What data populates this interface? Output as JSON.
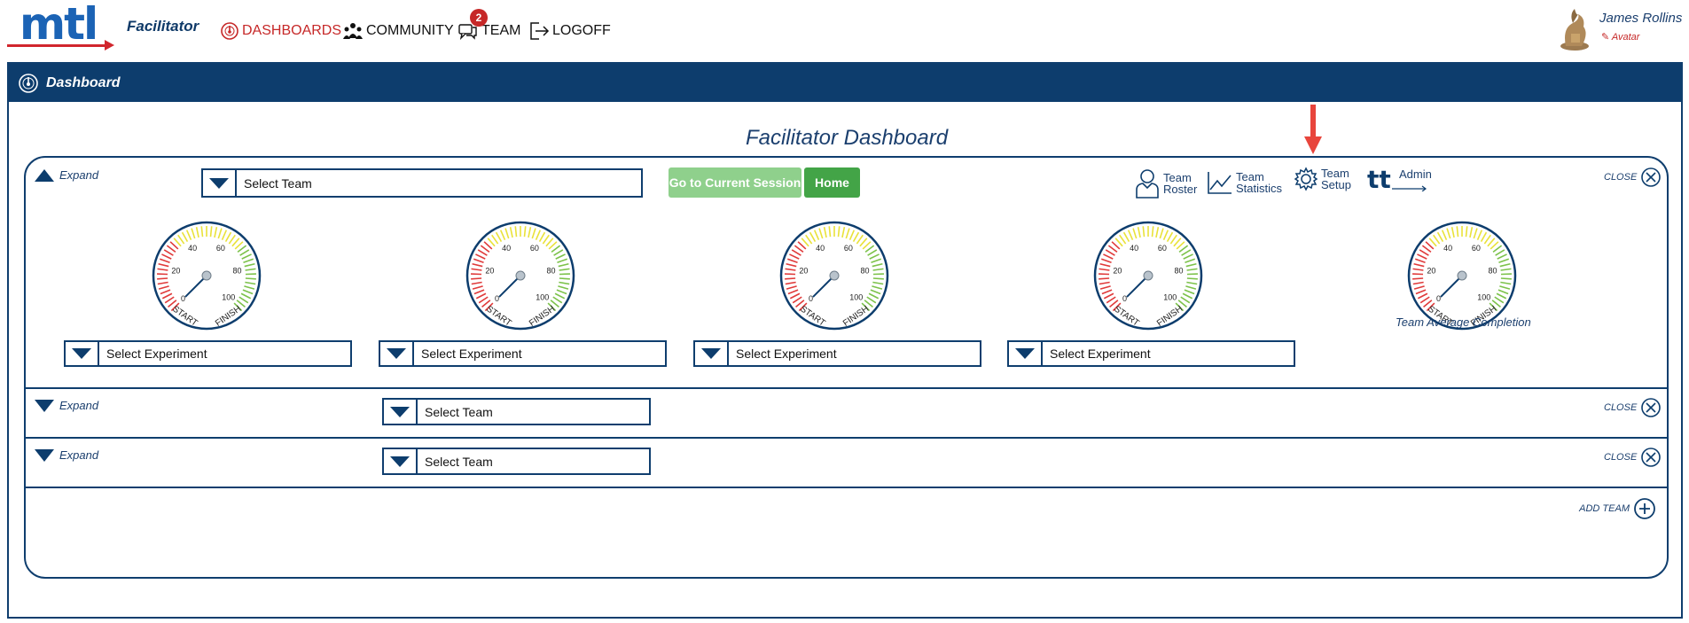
{
  "app": {
    "logo_text": "mtl",
    "role": "Facilitator"
  },
  "nav": {
    "dashboards": "DASHBOARDS",
    "community": "COMMUNITY",
    "team": "TEAM",
    "team_badge": "2",
    "logoff": "LOGOFF"
  },
  "user": {
    "name": "James Rollins",
    "avatar_link": "Avatar"
  },
  "panel": {
    "header": "Dashboard",
    "title": "Facilitator Dashboard"
  },
  "toolbar": {
    "go_current_session": "Go to Current Session",
    "home": "Home",
    "team_roster": "Team Roster",
    "team_statistics": "Team Statistics",
    "team_setup": "Team Setup",
    "admin": "Admin"
  },
  "teams": [
    {
      "expand_label": "Expand",
      "select_label": "Select Team",
      "close_label": "CLOSE",
      "expanded": true
    },
    {
      "expand_label": "Expand",
      "select_label": "Select Team",
      "close_label": "CLOSE",
      "expanded": false
    },
    {
      "expand_label": "Expand",
      "select_label": "Select Team",
      "close_label": "CLOSE",
      "expanded": false
    }
  ],
  "gauges": {
    "tick_labels": [
      "0",
      "20",
      "40",
      "60",
      "80",
      "100"
    ],
    "start_label": "START",
    "finish_label": "FINISH",
    "average_caption": "Team Average Completion",
    "values": [
      0,
      0,
      0,
      0,
      0
    ]
  },
  "experiments": [
    {
      "select_label": "Select Experiment"
    },
    {
      "select_label": "Select Experiment"
    },
    {
      "select_label": "Select Experiment"
    },
    {
      "select_label": "Select Experiment"
    }
  ],
  "add_team_label": "ADD TEAM",
  "colors": {
    "navy": "#0d3d6d",
    "accent_red": "#c62828",
    "green": "#43a447",
    "light_green": "#8fd08c",
    "gauge_red": "#e03a3a",
    "gauge_yellow": "#e9e23a",
    "gauge_green": "#7cc24a"
  }
}
